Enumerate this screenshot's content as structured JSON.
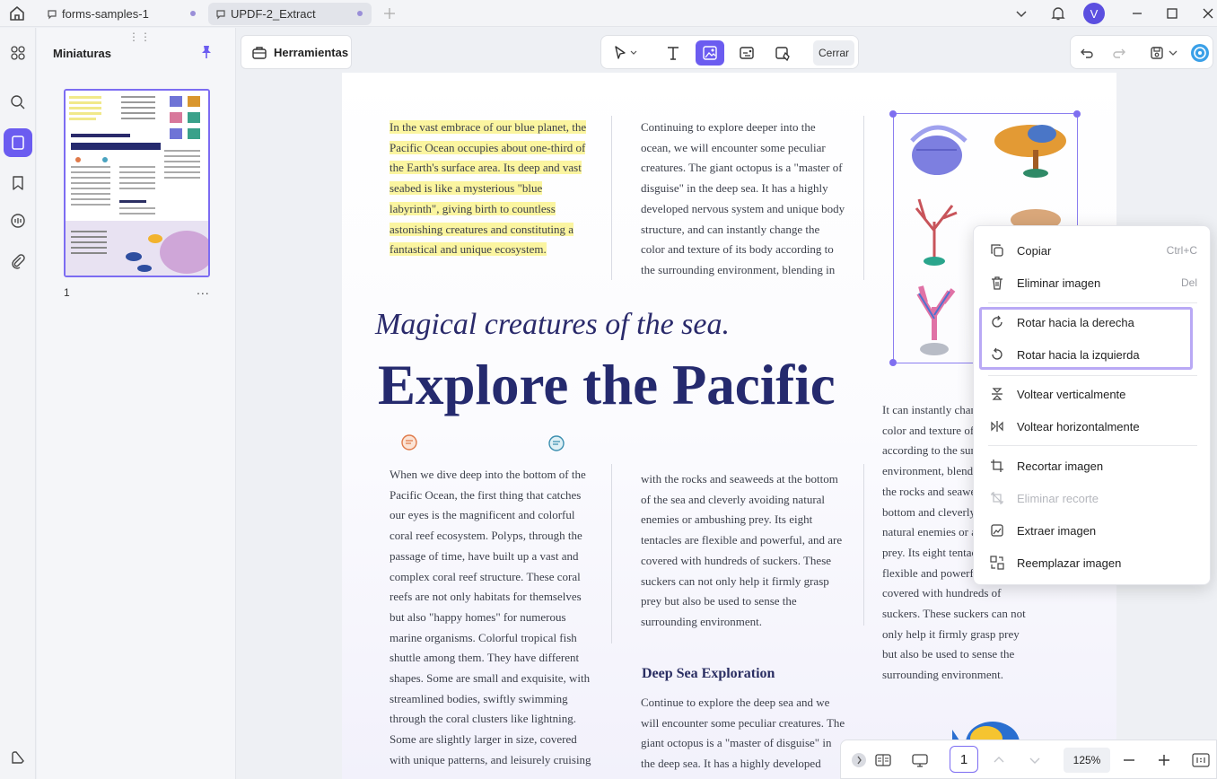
{
  "tabs": [
    {
      "label": "forms-samples-1"
    },
    {
      "label": "UPDF-2_Extract"
    }
  ],
  "user": {
    "initial": "V"
  },
  "sidebar": {
    "title": "Miniaturas",
    "page_number": "1",
    "more": "..."
  },
  "toolbar": {
    "tools_label": "Herramientas",
    "close_label": "Cerrar"
  },
  "document": {
    "top_left_paragraph": "In the vast embrace of our blue planet, the Pacific Ocean occupies about one-third of the Earth's surface area. Its deep and vast seabed is like a mysterious \"blue labyrinth\", giving birth to countless astonishing creatures and constituting a fantastical and unique ecosystem.",
    "top_middle_paragraph": "Continuing to explore deeper into the ocean, we will encounter some peculiar creatures. The giant octopus is a \"master of disguise\" in the deep sea. It has a highly developed nervous system and unique body structure, and can instantly change the color and texture of its body according to the surrounding environment, blending in",
    "subtitle": "Magical creatures of the sea.",
    "title": "Explore the Pacific",
    "bottom_left_paragraph": "When we dive deep into the bottom of the Pacific Ocean, the first thing that catches our eyes is the magnificent and colorful coral reef ecosystem. Polyps, through the passage of time, have built up a vast and complex coral reef structure. These coral reefs are not only habitats for themselves but also \"happy homes\" for numerous marine organisms. Colorful tropical fish shuttle among them. They have different shapes. Some are small and exquisite, with streamlined bodies, swiftly swimming through the coral clusters like lightning. Some are slightly larger in size, covered with unique patterns, and leisurely cruising",
    "bottom_middle_paragraph": "with the rocks and seaweeds at the bottom of the sea and cleverly avoiding natural enemies or ambushing prey. Its eight tentacles are flexible and powerful, and are covered with hundreds of suckers. These suckers can not only help it firmly grasp prey but also be used to sense the surrounding environment.",
    "right_paragraph": "It can instantly change the color and texture of its body according to the surrounding environment, blending in with the rocks and seaweeds at the bottom and cleverly avoiding natural enemies or ambushing prey. Its eight tentacles are flexible and powerful, and are covered with hundreds of suckers. These suckers can not only help it firmly grasp prey but also be used to sense the surrounding environment.",
    "section_title": "Deep Sea Exploration",
    "section_paragraph": "Continue to explore the deep sea and we will encounter some peculiar creatures. The giant octopus is a \"master of disguise\" in the deep sea. It has a highly developed"
  },
  "context_menu": {
    "items": [
      {
        "label": "Copiar",
        "shortcut": "Ctrl+C",
        "icon": "copy-icon"
      },
      {
        "label": "Eliminar imagen",
        "shortcut": "Del",
        "icon": "trash-icon"
      },
      {
        "label": "Rotar hacia la derecha",
        "icon": "rotate-right-icon"
      },
      {
        "label": "Rotar hacia la izquierda",
        "icon": "rotate-left-icon"
      },
      {
        "label": "Voltear verticalmente",
        "icon": "flip-vertical-icon"
      },
      {
        "label": "Voltear horizontalmente",
        "icon": "flip-horizontal-icon"
      },
      {
        "label": "Recortar imagen",
        "icon": "crop-icon"
      },
      {
        "label": "Eliminar recorte",
        "icon": "remove-crop-icon",
        "disabled": true
      },
      {
        "label": "Extraer imagen",
        "icon": "extract-icon"
      },
      {
        "label": "Reemplazar imagen",
        "icon": "replace-icon"
      }
    ]
  },
  "bottom_bar": {
    "page": "1",
    "zoom": "125%"
  },
  "colors": {
    "accent": "#6b5cf0",
    "highlight": "#fbf5a0",
    "title": "#252a6e"
  }
}
